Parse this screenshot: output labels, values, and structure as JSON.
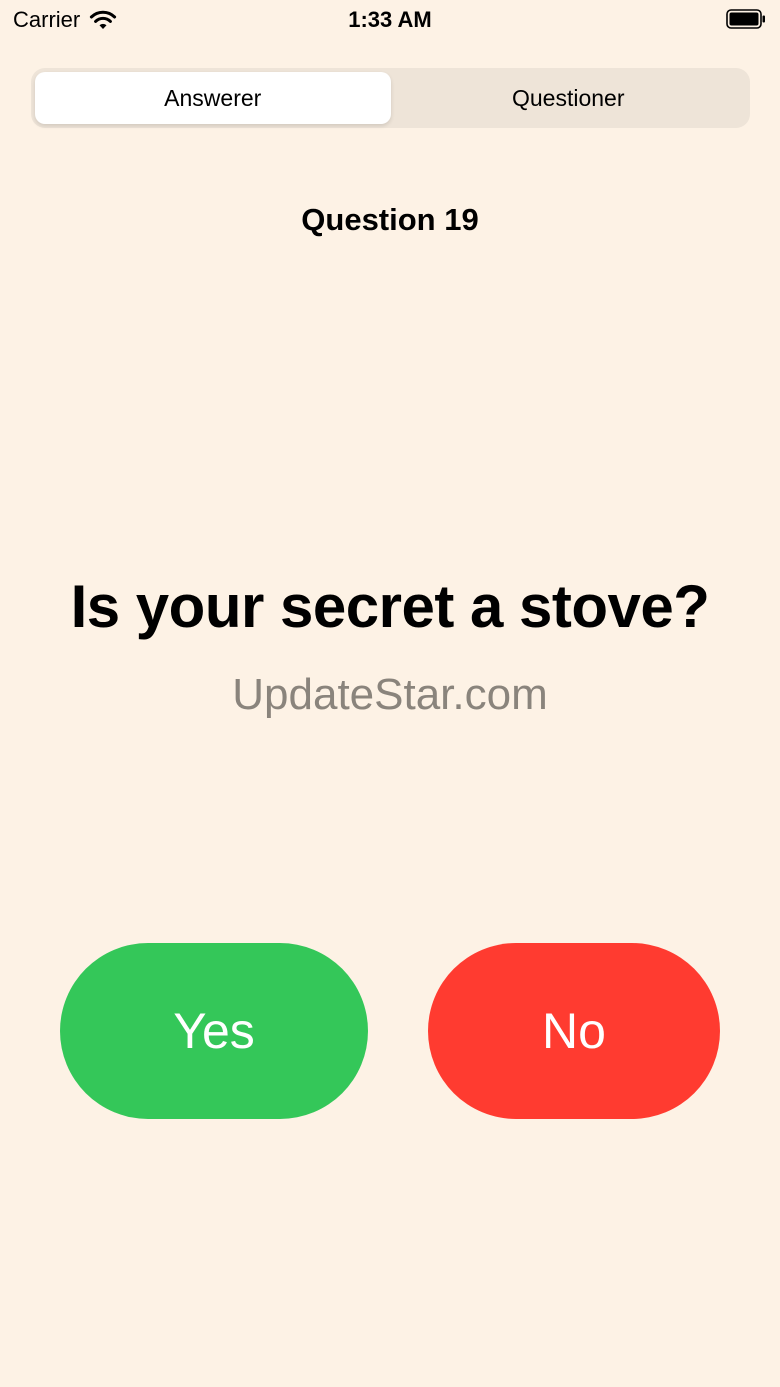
{
  "status_bar": {
    "carrier": "Carrier",
    "time": "1:33 AM"
  },
  "segmented_control": {
    "options": [
      {
        "label": "Answerer",
        "selected": true
      },
      {
        "label": "Questioner",
        "selected": false
      }
    ]
  },
  "question": {
    "number_label": "Question 19",
    "text": "Is your secret a stove?"
  },
  "watermark": "UpdateStar.com",
  "buttons": {
    "yes_label": "Yes",
    "no_label": "No"
  },
  "colors": {
    "background": "#fdf2e5",
    "yes": "#34c759",
    "no": "#ff3b30"
  }
}
